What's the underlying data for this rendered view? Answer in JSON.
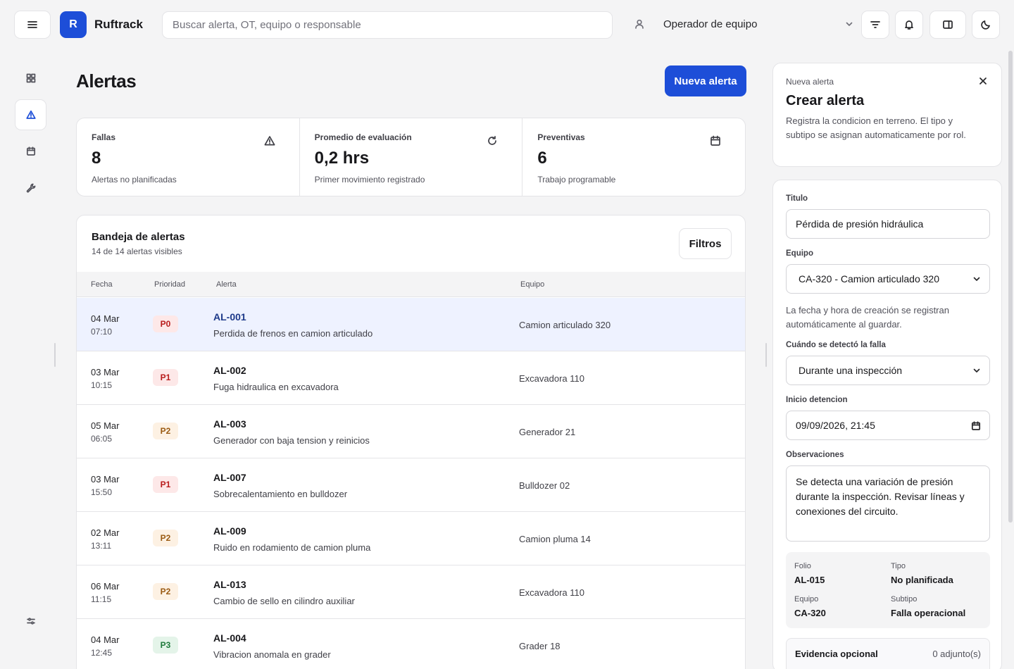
{
  "header": {
    "brand": "Ruftrack",
    "logo_letter": "R",
    "search_placeholder": "Buscar alerta, OT, equipo o responsable",
    "role": "Operador de equipo"
  },
  "main": {
    "title": "Alertas",
    "new_alert_label": "Nueva alerta",
    "stats": [
      {
        "label": "Fallas",
        "value": "8",
        "sub": "Alertas no planificadas",
        "icon": "warning-icon"
      },
      {
        "label": "Promedio de evaluación",
        "value": "0,2 hrs",
        "sub": "Primer movimiento registrado",
        "icon": "refresh-icon"
      },
      {
        "label": "Preventivas",
        "value": "6",
        "sub": "Trabajo programable",
        "icon": "calendar-icon"
      }
    ],
    "inbox": {
      "title": "Bandeja de alertas",
      "subtitle": "14 de 14 alertas visibles",
      "filters_label": "Filtros",
      "columns": [
        "Fecha",
        "Prioridad",
        "Alerta",
        "Equipo"
      ],
      "rows": [
        {
          "date": "04 Mar",
          "time": "07:10",
          "priority": "P0",
          "id": "AL-001",
          "desc": "Perdida de frenos en camion articulado",
          "equipment": "Camion articulado 320",
          "selected": true
        },
        {
          "date": "03 Mar",
          "time": "10:15",
          "priority": "P1",
          "id": "AL-002",
          "desc": "Fuga hidraulica en excavadora",
          "equipment": "Excavadora 110"
        },
        {
          "date": "05 Mar",
          "time": "06:05",
          "priority": "P2",
          "id": "AL-003",
          "desc": "Generador con baja tension y reinicios",
          "equipment": "Generador 21"
        },
        {
          "date": "03 Mar",
          "time": "15:50",
          "priority": "P1",
          "id": "AL-007",
          "desc": "Sobrecalentamiento en bulldozer",
          "equipment": "Bulldozer 02"
        },
        {
          "date": "02 Mar",
          "time": "13:11",
          "priority": "P2",
          "id": "AL-009",
          "desc": "Ruido en rodamiento de camion pluma",
          "equipment": "Camion pluma 14"
        },
        {
          "date": "06 Mar",
          "time": "11:15",
          "priority": "P2",
          "id": "AL-013",
          "desc": "Cambio de sello en cilindro auxiliar",
          "equipment": "Excavadora 110"
        },
        {
          "date": "04 Mar",
          "time": "12:45",
          "priority": "P3",
          "id": "AL-004",
          "desc": "Vibracion anomala en grader",
          "equipment": "Grader 18"
        }
      ]
    }
  },
  "panel": {
    "eyebrow": "Nueva alerta",
    "title": "Crear alerta",
    "description": "Registra la condicion en terreno. El tipo y subtipo se asignan automaticamente por rol.",
    "form": {
      "title_label": "Titulo",
      "title_value": "Pérdida de presión hidráulica",
      "equipment_label": "Equipo",
      "equipment_value": "CA-320 - Camion articulado 320",
      "datetime_note": "La fecha y hora de creación se registran automáticamente al guardar.",
      "detected_label": "Cuándo se detectó la falla",
      "detected_value": "Durante una inspección",
      "start_label": "Inicio detencion",
      "start_value": "09/09/2026, 21:45",
      "obs_label": "Observaciones",
      "obs_value": "Se detecta una variación de presión durante la inspección. Revisar líneas y conexiones del circuito."
    },
    "summary": {
      "folio_label": "Folio",
      "folio": "AL-015",
      "type_label": "Tipo",
      "type": "No planificada",
      "equipment_label": "Equipo",
      "equipment": "CA-320",
      "subtype_label": "Subtipo",
      "subtype": "Falla operacional"
    },
    "evidence": {
      "label": "Evidencia opcional",
      "count": "0 adjunto(s)"
    }
  }
}
